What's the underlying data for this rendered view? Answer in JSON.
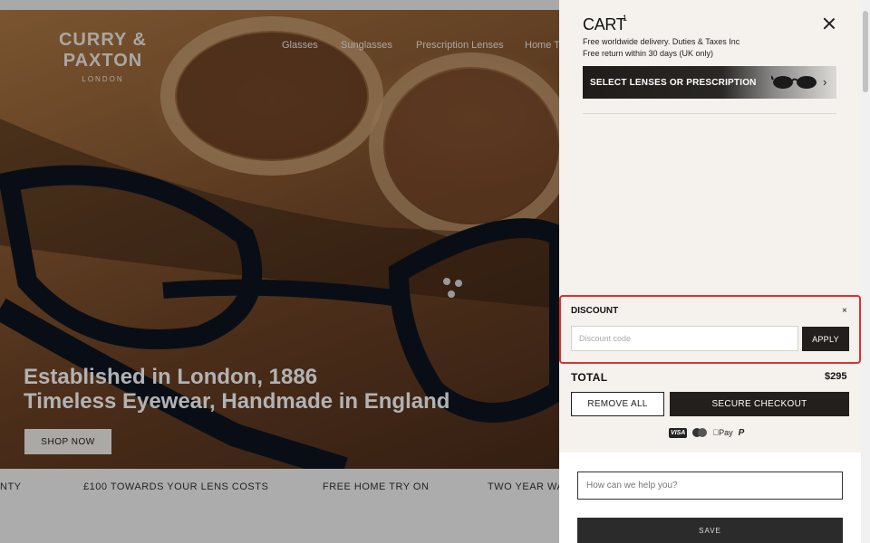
{
  "brand": {
    "name": "CURRY & PAXTON",
    "sub": "LONDON"
  },
  "nav": {
    "items": [
      "Glasses",
      "Sunglasses",
      "Prescription Lenses",
      "Home T"
    ]
  },
  "hero": {
    "title_line1": "Established in London, 1886",
    "title_line2": "Timeless Eyewear, Handmade in England",
    "cta": "SHOP NOW"
  },
  "marquee": {
    "items": [
      "NTY",
      "£100 TOWARDS YOUR LENS COSTS",
      "FREE HOME TRY ON",
      "TWO YEAR WA"
    ]
  },
  "cart": {
    "title": "CART",
    "count": "1",
    "shipping_line1": "Free worldwide delivery. Duties & Taxes Inc",
    "shipping_line2": "Free return within 30 days (UK only)",
    "lens_banner": "SELECT LENSES OR PRESCRIPTION",
    "discount": {
      "label": "DISCOUNT",
      "close": "×",
      "placeholder": "Discount code",
      "apply": "APPLY"
    },
    "total_label": "TOTAL",
    "total_value": "$295",
    "remove_all": "REMOVE ALL",
    "checkout": "SECURE CHECKOUT",
    "payments": {
      "visa": "VISA",
      "applepay": "Pay",
      "paypal": "P"
    }
  },
  "help": {
    "placeholder": "How can we help you?",
    "save": "SAVE"
  },
  "colors": {
    "accent_dark": "#231f1c",
    "highlight": "#e0302e",
    "drawer_bg": "#f5f2ee"
  }
}
